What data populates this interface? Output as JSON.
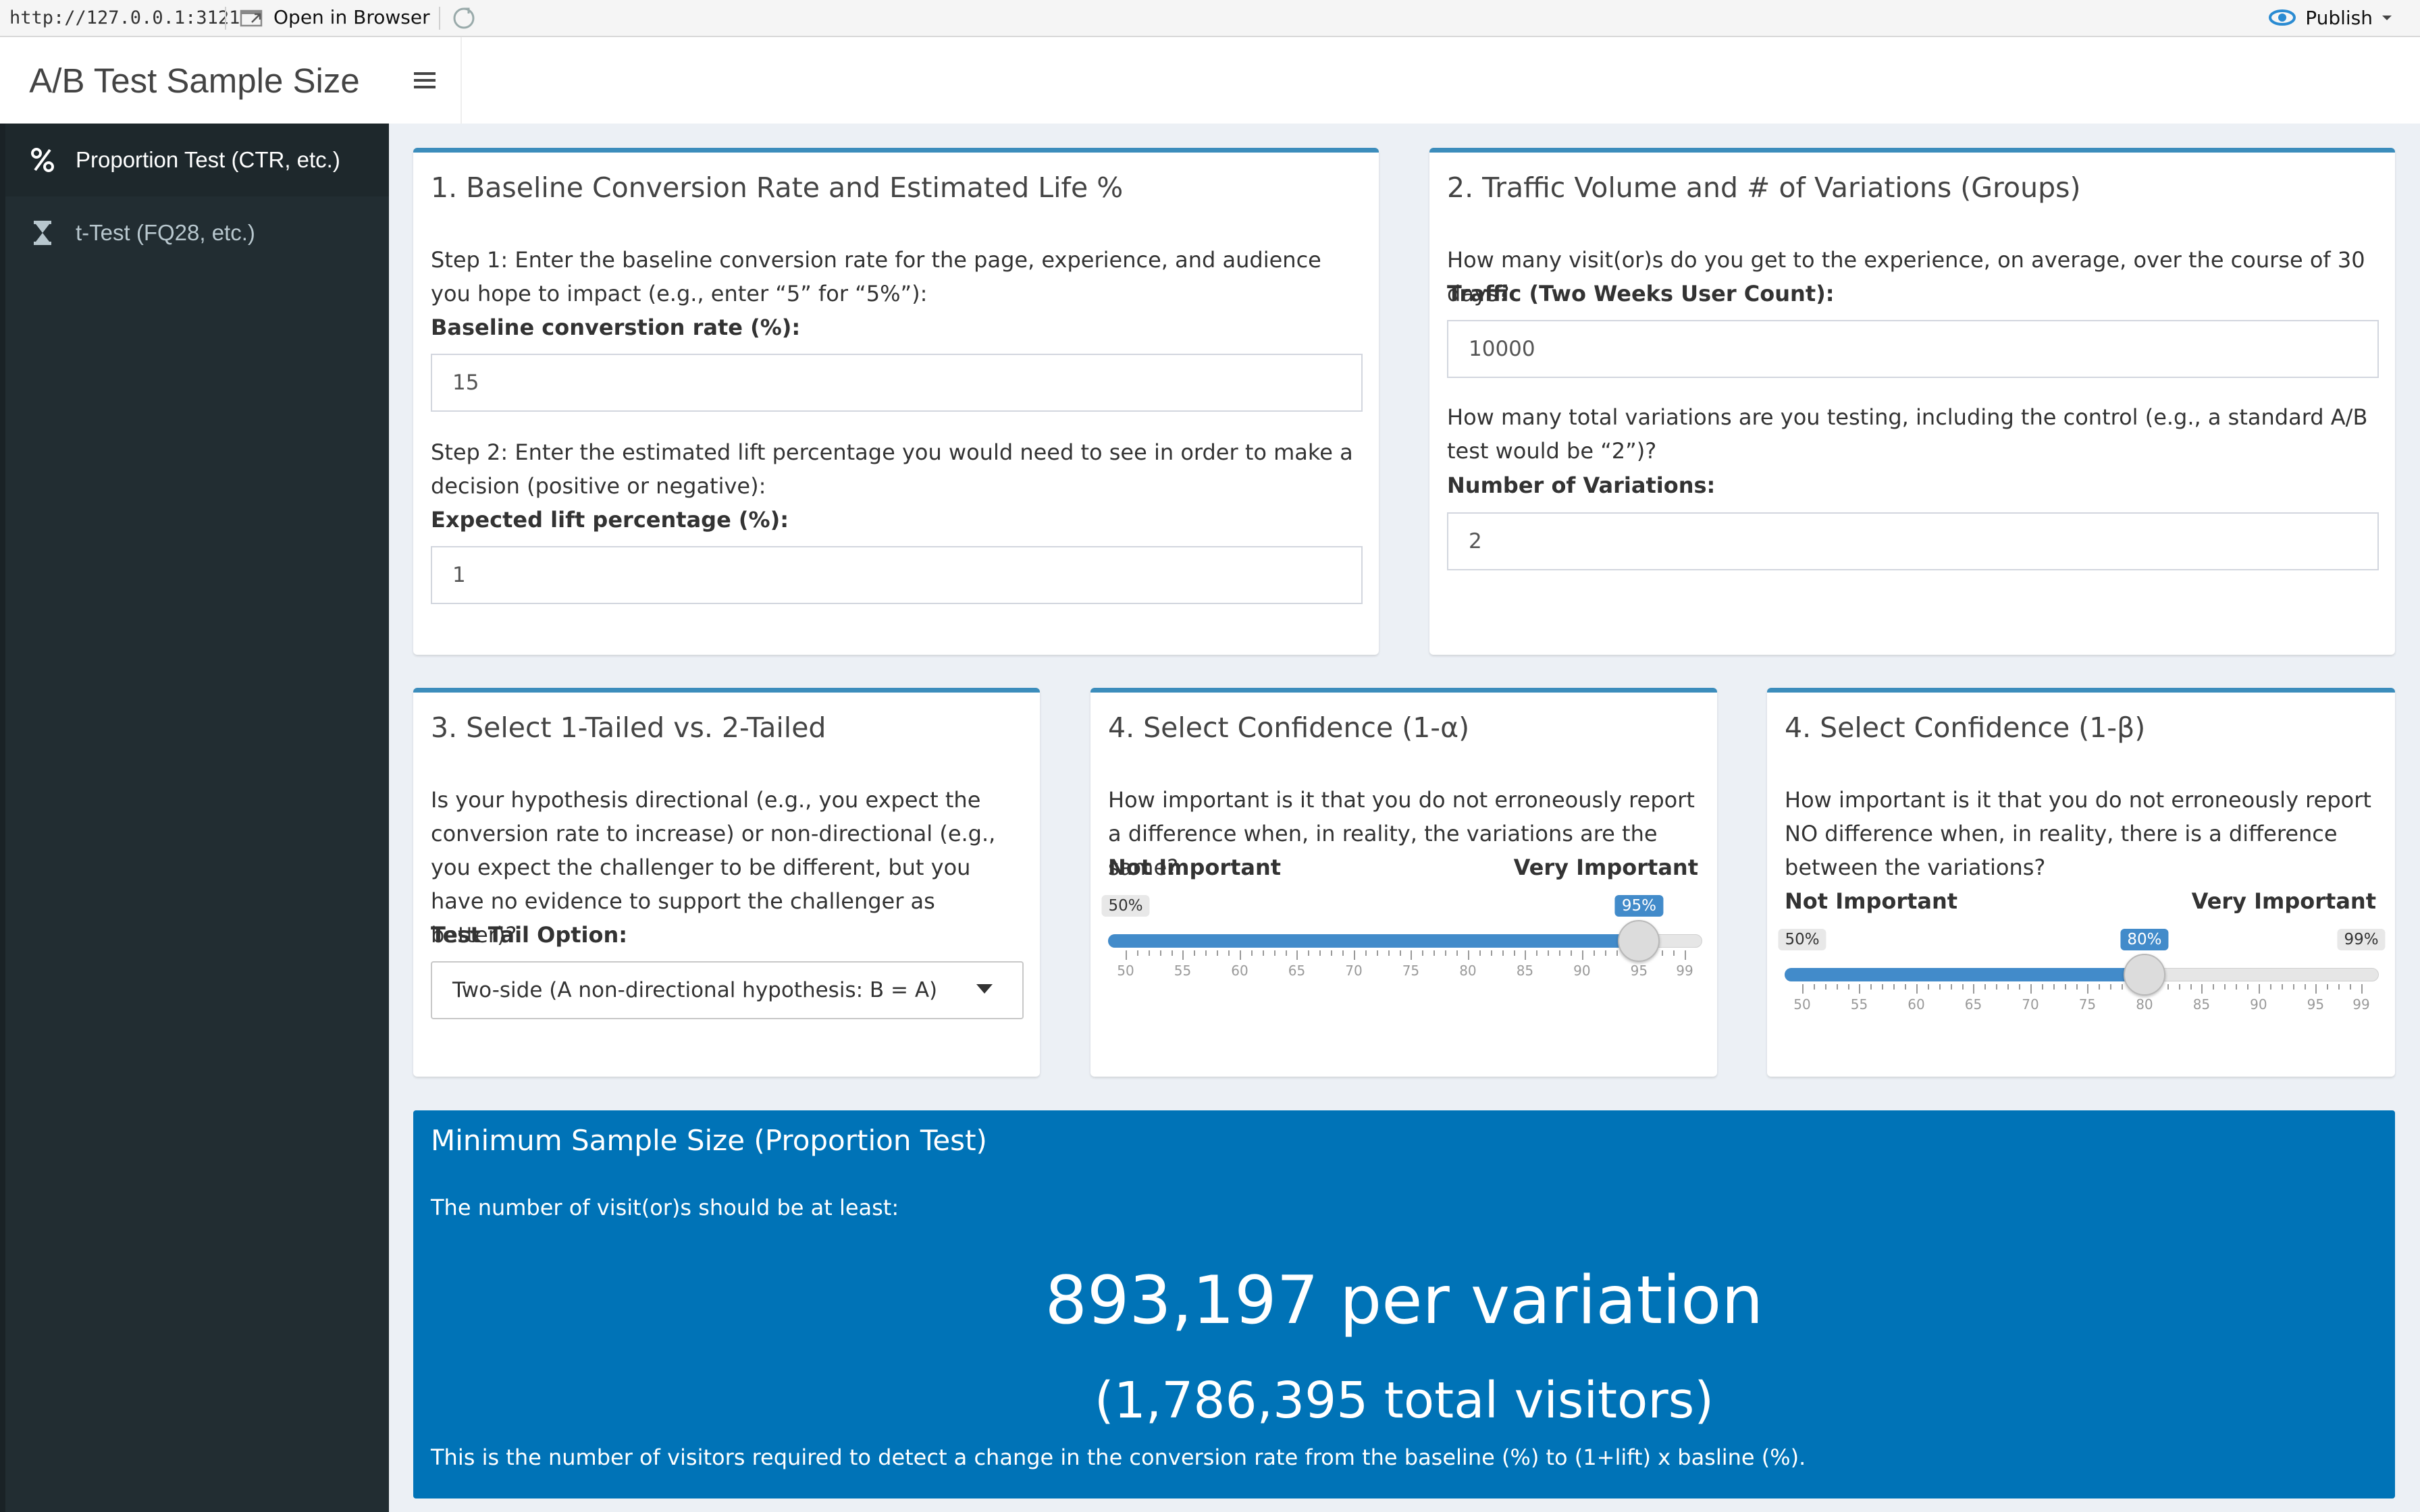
{
  "viewer": {
    "url": "http://127.0.0.1:3121",
    "open_in_browser": "Open in Browser",
    "publish": "Publish"
  },
  "app": {
    "title": "A/B Test Sample Size"
  },
  "sidebar": {
    "items": [
      {
        "label": "Proportion Test (CTR, etc.)",
        "icon": "percent-icon",
        "active": true
      },
      {
        "label": "t-Test (FQ28, etc.)",
        "icon": "hourglass-icon",
        "active": false
      }
    ]
  },
  "box1": {
    "title": "1. Baseline Conversion Rate and Estimated Life %",
    "step1": "Step 1: Enter the baseline conversion rate for the page, experience, and audience you hope to impact (e.g., enter “5” for “5%”):",
    "baseline_label": "Baseline converstion rate (%):",
    "baseline_value": "15",
    "step2": "Step 2: Enter the estimated lift percentage you would need to see in order to make a decision (positive or negative):",
    "lift_label": "Expected lift percentage (%):",
    "lift_value": "1"
  },
  "box2": {
    "title": "2. Traffic Volume and # of Variations (Groups)",
    "traffic_desc": "How many visit(or)s do you get to the experience, on average, over the course of 30 days?",
    "traffic_label": "Traffic (Two Weeks User Count):",
    "traffic_value": "10000",
    "variations_desc": "How many total variations are you testing, including the control (e.g., a standard A/B test would be “2”)?",
    "variations_label": "Number of Variations:",
    "variations_value": "2"
  },
  "box3": {
    "title": "3. Select 1-Tailed vs. 2-Tailed",
    "desc": "Is your hypothesis directional (e.g., you expect the conversion rate to increase) or non-directional (e.g., you expect the challenger to be different, but you have no evidence to support the challenger as better)?",
    "tail_label": "Test Tail Option:",
    "tail_value": "Two-side (A non-directional hypothesis: B = A)"
  },
  "box4": {
    "title": "4. Select Confidence (1-α)",
    "desc": "How important is it that you do not erroneously report a difference when, in reality, the variations are the same?",
    "left_label": "Not Important",
    "right_label": "Very Important",
    "min_label": "50%",
    "value_label": "95%",
    "min": 50,
    "max": 99,
    "value": 95,
    "ticks": [
      "50",
      "55",
      "60",
      "65",
      "70",
      "75",
      "80",
      "85",
      "90",
      "95",
      "99"
    ]
  },
  "box5": {
    "title": "4. Select Confidence (1-β)",
    "desc": "How important is it that you do not erroneously report NO difference when, in reality, there is a difference between the variations?",
    "left_label": "Not Important",
    "right_label": "Very Important",
    "min_label": "50%",
    "max_label": "99%",
    "value_label": "80%",
    "min": 50,
    "max": 99,
    "value": 80,
    "ticks": [
      "50",
      "55",
      "60",
      "65",
      "70",
      "75",
      "80",
      "85",
      "90",
      "95",
      "99"
    ]
  },
  "result": {
    "title": "Minimum Sample Size (Proportion Test)",
    "subtitle": "The number of visit(or)s should be at least:",
    "per_variation": "893,197 per variation",
    "total": "(1,786,395 total visitors)",
    "note": "This is the number of visitors required to detect a change in the conversion rate from the baseline (%) to (1+lift) x basline (%)."
  },
  "colors": {
    "accent": "#3c8dbc",
    "result_bg": "#0073b7",
    "sidebar_bg": "#222d32",
    "slider_fill": "#428bca"
  }
}
